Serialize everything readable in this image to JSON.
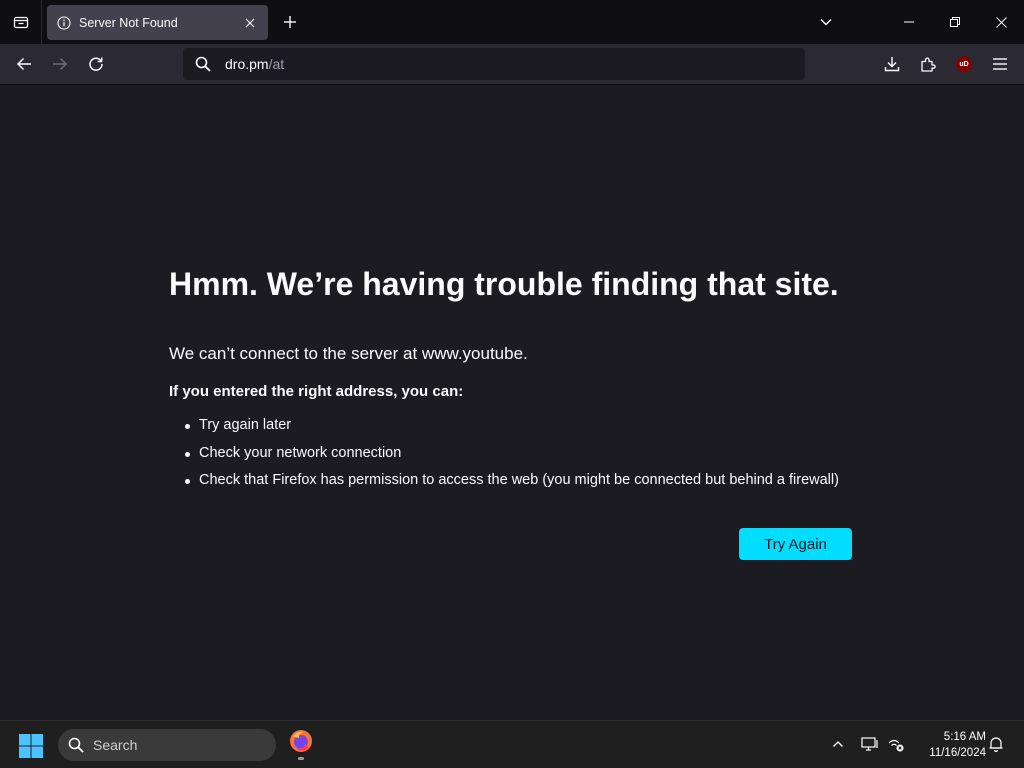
{
  "tabs": [
    {
      "title": "Server Not Found",
      "active": true
    }
  ],
  "urlbar": {
    "host": "dro.pm",
    "path": "/at"
  },
  "error": {
    "title": "Hmm. We’re having trouble finding that site.",
    "description": "We can’t connect to the server at www.youtube.",
    "subhead": "If you entered the right address, you can:",
    "suggestions": [
      "Try again later",
      "Check your network connection",
      "Check that Firefox has permission to access the web (you might be connected but behind a firewall)"
    ],
    "button_label": "Try Again"
  },
  "extensions": {
    "ublock_badge": "uD"
  },
  "taskbar": {
    "search_label": "Search",
    "time": "5:16 AM",
    "date": "11/16/2024"
  },
  "colors": {
    "accent": "#00ddff",
    "page_bg": "#1c1b22",
    "toolbar_bg": "#2b2a33",
    "tabstrip_bg": "#0f0f13"
  }
}
